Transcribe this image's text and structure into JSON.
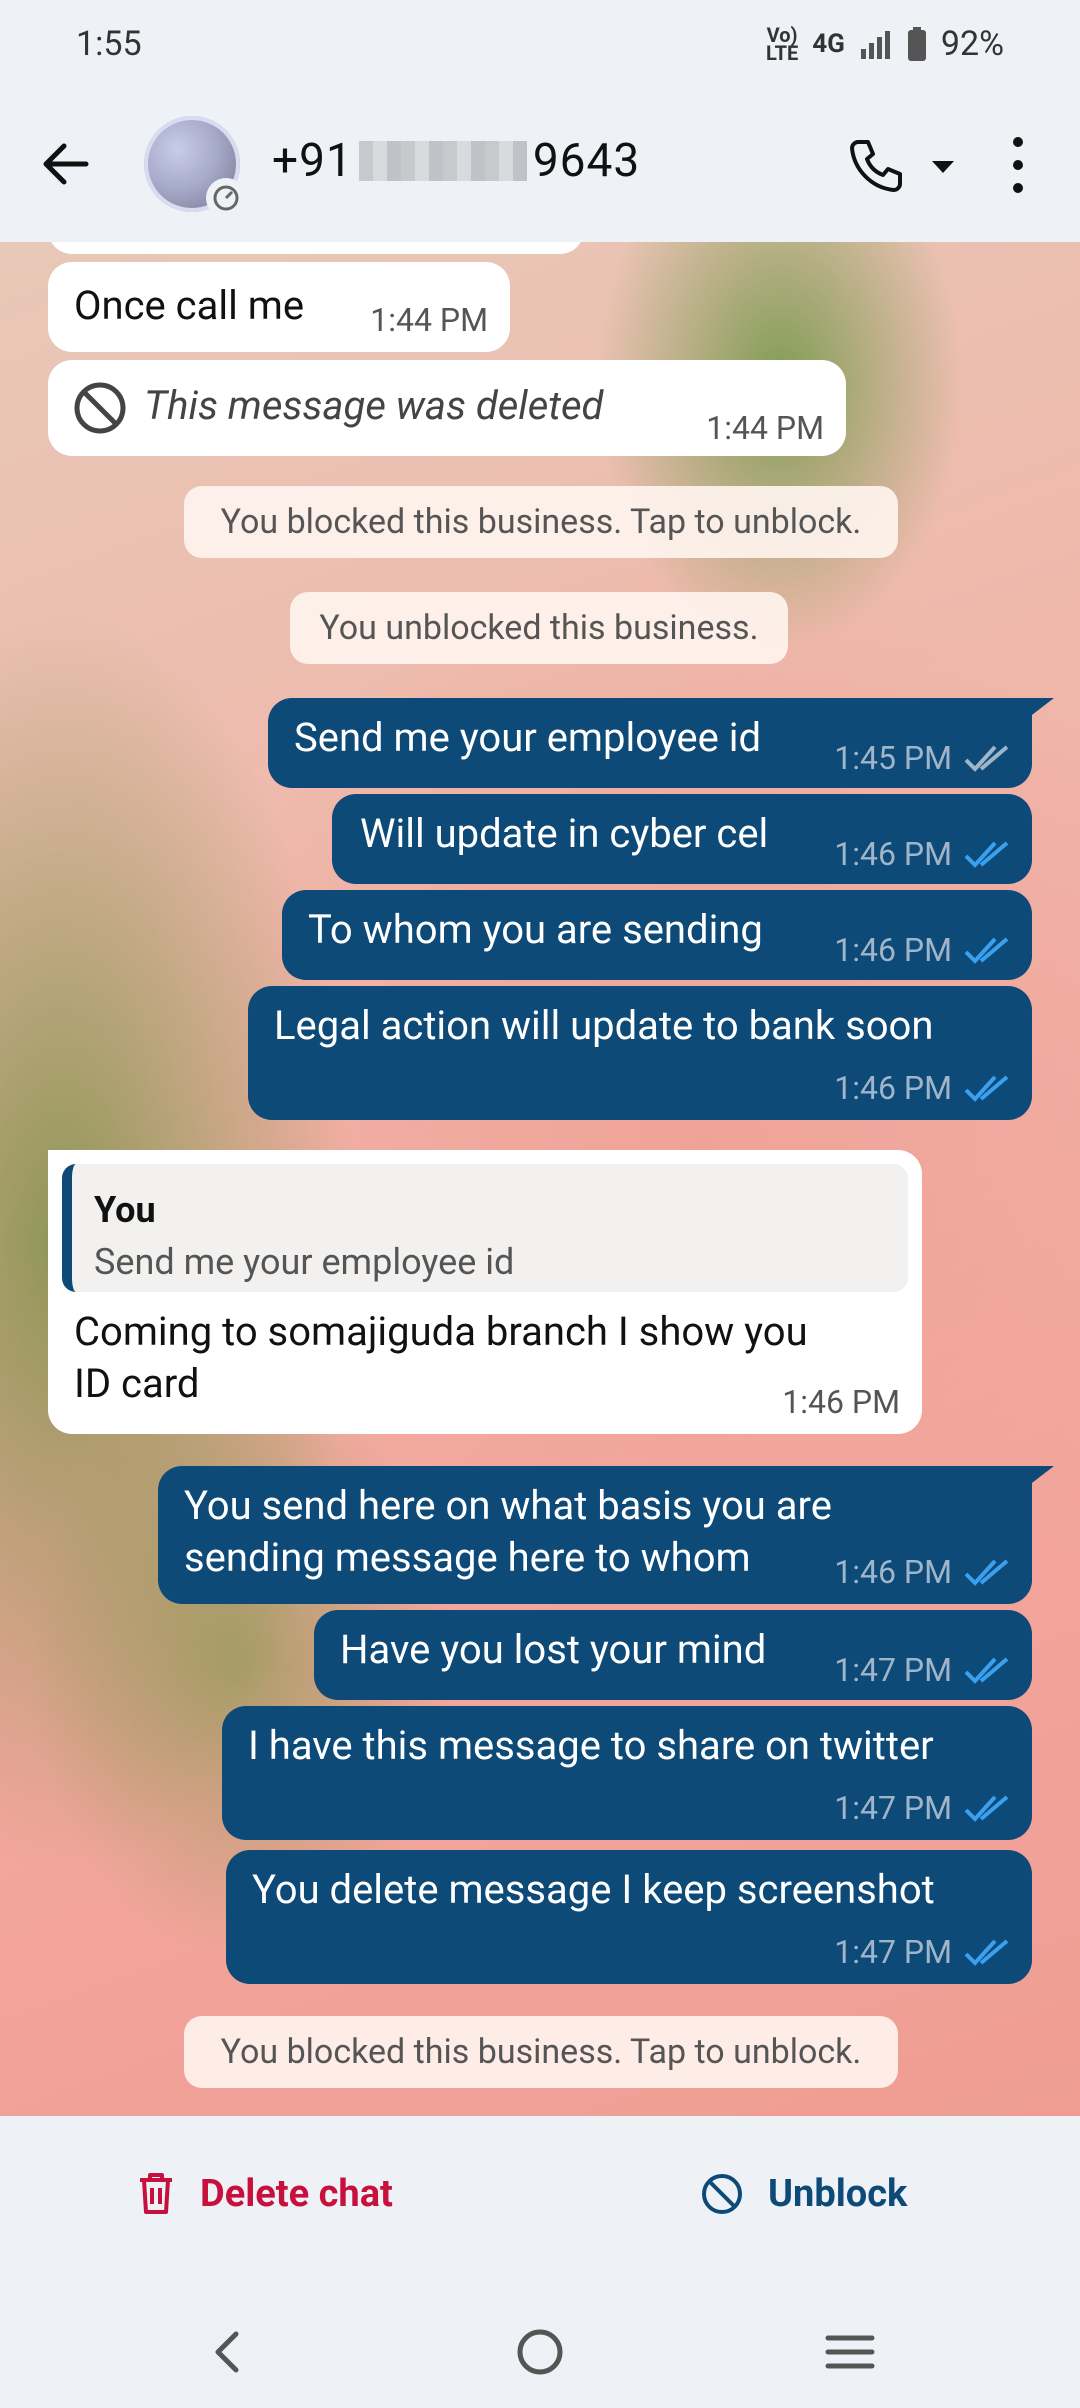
{
  "status_bar": {
    "time": "1:55",
    "network": "Vo) LTE",
    "signal": "4G",
    "battery": "92%"
  },
  "header": {
    "contact_prefix": "+91",
    "contact_suffix": "9643"
  },
  "messages": {
    "in_partial_1": {
      "text": "Once call me",
      "time": "1:44 PM"
    },
    "in_deleted": {
      "text": "This message was deleted",
      "time": "1:44 PM"
    },
    "sys_blocked_1": "You blocked this business. Tap to unblock.",
    "sys_unblocked": "You unblocked this business.",
    "out_1": {
      "text": "Send me your employee id",
      "time": "1:45 PM"
    },
    "out_2": {
      "text": "Will update in cyber cel",
      "time": "1:46 PM"
    },
    "out_3": {
      "text": "To whom you are sending",
      "time": "1:46 PM"
    },
    "out_4": {
      "text": "Legal action will update to bank soon",
      "time": "1:46 PM"
    },
    "in_reply": {
      "quote_author": "You",
      "quote_text": "Send me your employee id",
      "text_line1": "Coming to somajiguda branch I show you",
      "text_line2": "ID card",
      "time": "1:46 PM"
    },
    "out_5": {
      "line1": "You send here on what basis you are",
      "line2": "sending message here to whom",
      "time": "1:46 PM"
    },
    "out_6": {
      "text": "Have you lost your mind",
      "time": "1:47 PM"
    },
    "out_7": {
      "text": "I have this message to share on twitter",
      "time": "1:47 PM"
    },
    "out_8": {
      "text": "You delete message I keep screenshot",
      "time": "1:47 PM"
    },
    "sys_blocked_2": "You blocked this business. Tap to unblock."
  },
  "actions": {
    "delete_label": "Delete chat",
    "unblock_label": "Unblock"
  },
  "colors": {
    "outgoing_bubble": "#0d4a78",
    "read_tick": "#3aa0f0",
    "delete_red": "#c8103c"
  }
}
